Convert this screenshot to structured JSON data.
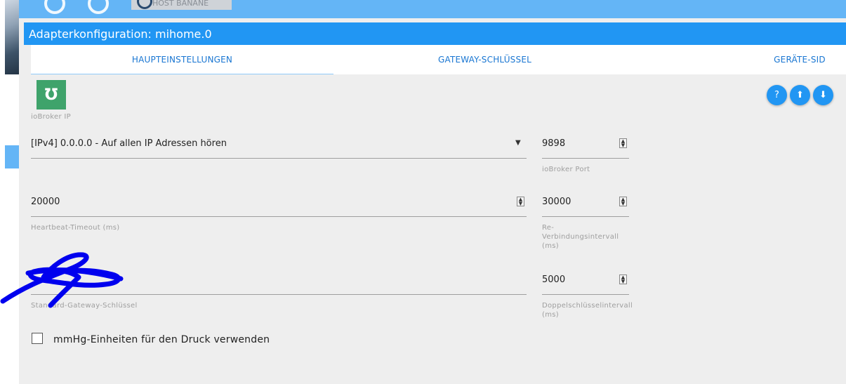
{
  "header": {
    "title": "Adapterkonfiguration: mihome.0",
    "host_button_label": "HOST BANANE"
  },
  "tabs": [
    {
      "label": "HAUPTEINSTELLUNGEN",
      "active": true
    },
    {
      "label": "GATEWAY-SCHLÜSSEL",
      "active": false
    },
    {
      "label": "GERÄTE-SID",
      "active": false
    }
  ],
  "logo": {
    "icon": "mihome-logo-icon",
    "glyph": "Ʊ"
  },
  "actions": {
    "help_icon": "?",
    "upload_icon": "⬆",
    "download_icon": "⬇"
  },
  "fields": {
    "broker_ip": {
      "label": "ioBroker IP",
      "value": "[IPv4] 0.0.0.0 - Auf allen IP Adressen hören"
    },
    "broker_port": {
      "label": "ioBroker Port",
      "value": "9898"
    },
    "heartbeat": {
      "label": "Heartbeat-Timeout (ms)",
      "value": "20000"
    },
    "reconnect": {
      "label": "Re-Verbindungsintervall (ms)",
      "value": "30000"
    },
    "gateway_key": {
      "label": "Standard-Gateway-Schlüssel",
      "value": ""
    },
    "double_key": {
      "label": "Doppelschlüsselintervall (ms)",
      "value": "5000"
    }
  },
  "checkbox": {
    "label": "mmHg-Einheiten für den Druck verwenden",
    "checked": false
  },
  "colors": {
    "primary": "#2196f3",
    "topbar": "#64b5f6",
    "logo_green": "#3fa36b",
    "scribble": "#0000ee"
  }
}
